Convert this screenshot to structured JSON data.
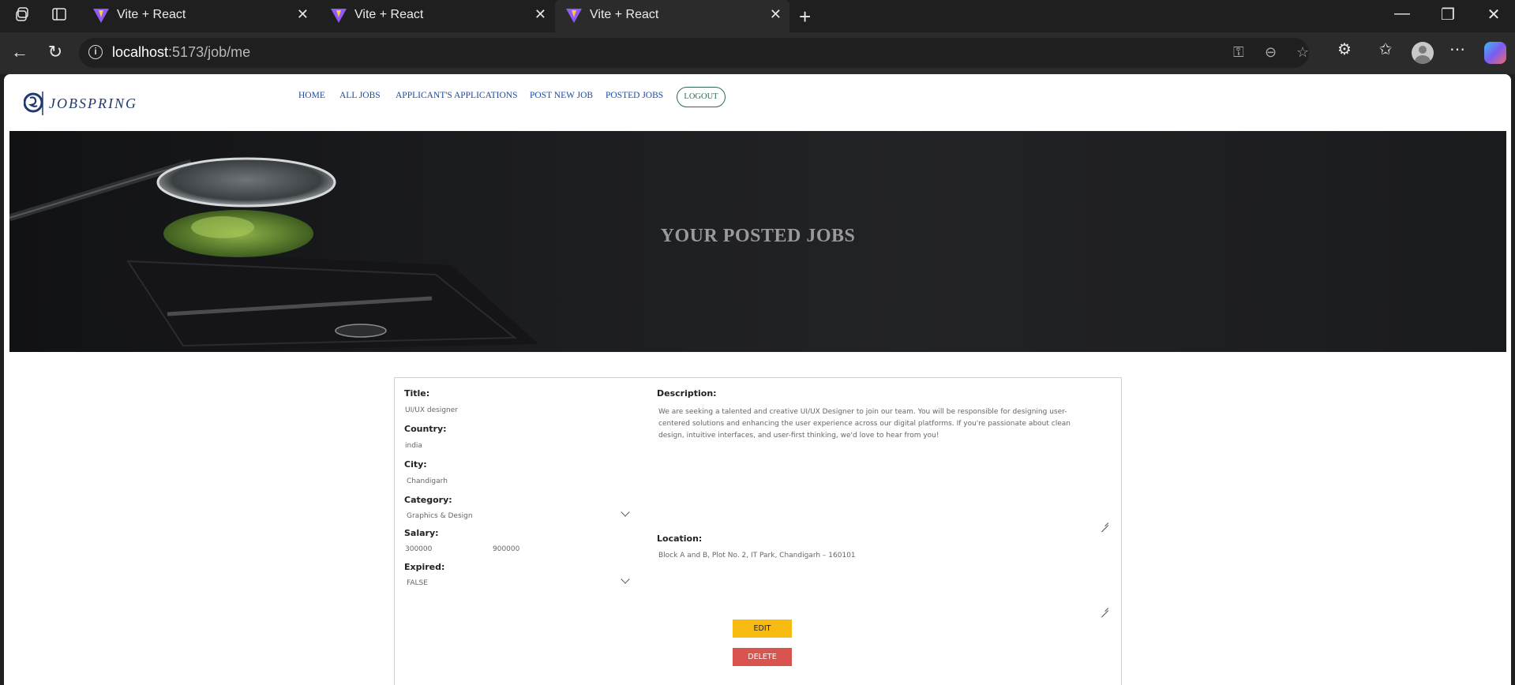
{
  "browser": {
    "tabs": [
      {
        "title": "Vite + React"
      },
      {
        "title": "Vite + React"
      },
      {
        "title": "Vite + React"
      }
    ],
    "address": {
      "host": "localhost",
      "path": ":5173/job/me"
    }
  },
  "site": {
    "logo_text": "JOBSPRING",
    "nav": [
      {
        "label": "HOME"
      },
      {
        "label": "ALL JOBS"
      },
      {
        "label": "APPLICANT'S APPLICATIONS"
      },
      {
        "label": "POST NEW JOB"
      },
      {
        "label": "POSTED JOBS"
      }
    ],
    "logout_label": "LOGOUT"
  },
  "hero": {
    "title": "YOUR POSTED JOBS"
  },
  "job": {
    "title_label": "Title:",
    "title_value": "UI/UX designer",
    "country_label": "Country:",
    "country_value": "india",
    "city_label": "City:",
    "city_value": "Chandigarh",
    "category_label": "Category:",
    "category_value": "Graphics & Design",
    "salary_label": "Salary:",
    "salary_from": "300000",
    "salary_to": "900000",
    "expired_label": "Expired:",
    "expired_value": "FALSE",
    "description_label": "Description:",
    "description_value": "We are seeking a talented and creative UI/UX Designer to join our team. You will be responsible for designing user-centered solutions and enhancing the user experience across our digital platforms. If you're passionate about clean design, intuitive interfaces, and user-first thinking, we'd love to hear from you!",
    "location_label": "Location:",
    "location_value": "Block A and B, Plot No. 2, IT Park, Chandigarh – 160101",
    "edit_label": "EDIT",
    "delete_label": "DELETE"
  }
}
